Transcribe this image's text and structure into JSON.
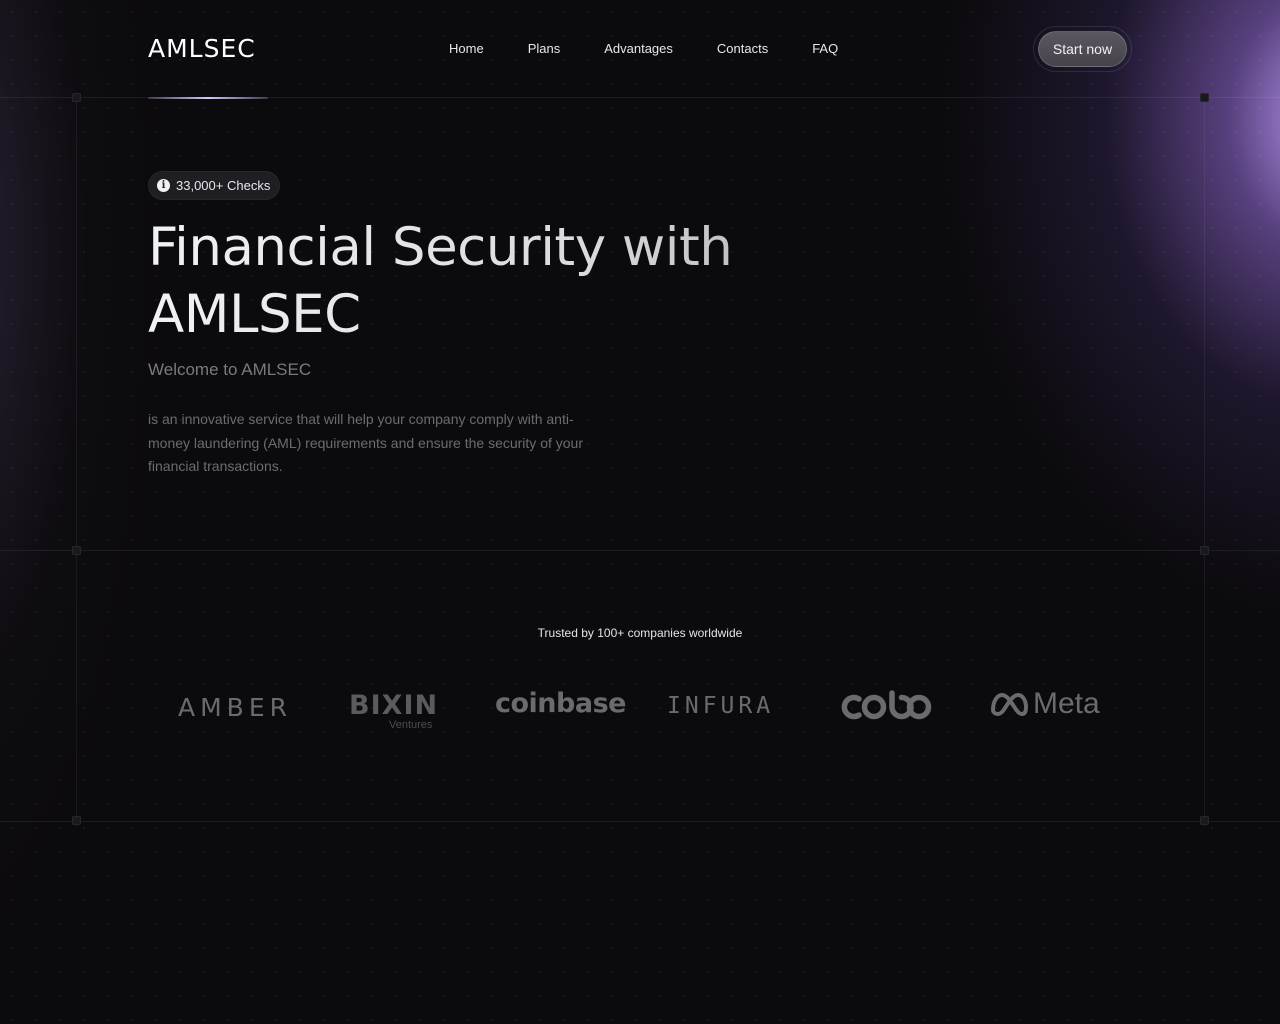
{
  "header": {
    "logo": "AMLSEC",
    "nav": [
      {
        "label": "Home"
      },
      {
        "label": "Plans"
      },
      {
        "label": "Advantages"
      },
      {
        "label": "Contacts"
      },
      {
        "label": "FAQ"
      }
    ],
    "cta_label": "Start now"
  },
  "hero": {
    "badge_text": "33,000+ Checks",
    "headline_line1": "Financial Security with",
    "headline_line2": "AMLSEC",
    "welcome": "Welcome to AMLSEC",
    "description": "is an innovative service that will help your company comply with anti-money laundering (AML) requirements and ensure the security of your financial transactions."
  },
  "trusted": {
    "title": "Trusted by 100+ companies worldwide",
    "brands": [
      {
        "name": "AMBER"
      },
      {
        "name": "BIXIN",
        "sub": "Ventures"
      },
      {
        "name": "coinbase"
      },
      {
        "name": "INFURA"
      },
      {
        "name": "cobo"
      },
      {
        "name": "Meta"
      }
    ]
  },
  "colors": {
    "background": "#0b0a0c",
    "accent_glow": "#c4a0ff",
    "muted_text": "#6d6b72",
    "logo_gray": "#6c6a70"
  }
}
